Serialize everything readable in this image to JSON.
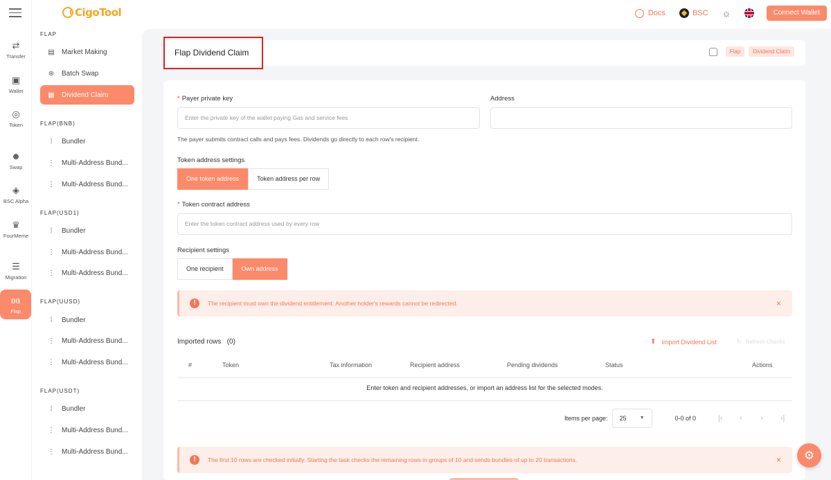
{
  "app": {
    "logo_text": "CigoTool",
    "docs_label": "Docs",
    "network_label": "BSC",
    "connect_label": "Connect Wallet"
  },
  "rail": [
    {
      "label": "Transfer",
      "icon": "transfer-icon"
    },
    {
      "label": "Wallet",
      "icon": "wallet-icon"
    },
    {
      "label": "Token",
      "icon": "token-icon"
    },
    {
      "label": "Swap",
      "icon": "swap-icon"
    },
    {
      "label": "BSC Alpha",
      "icon": "bsc-alpha-icon"
    },
    {
      "label": "FourMeme",
      "icon": "fourmeme-icon"
    },
    {
      "label": "Migration",
      "icon": "migration-icon"
    },
    {
      "label": "Flap",
      "icon": "butterfly-icon",
      "active": true
    }
  ],
  "subnav": {
    "groups": [
      {
        "label": "FLAP",
        "items": [
          "Market Making",
          "Batch Swap",
          "Dividend Claim"
        ]
      },
      {
        "label": "FLAP(BNB)",
        "items": [
          "Bundler",
          "Multi-Address Bund...",
          "Multi-Address Bund..."
        ]
      },
      {
        "label": "FLAP(USD1)",
        "items": [
          "Bundler",
          "Multi-Address Bund...",
          "Multi-Address Bund..."
        ]
      },
      {
        "label": "FLAP(UUSD)",
        "items": [
          "Bundler",
          "Multi-Address Bund...",
          "Multi-Address Bund..."
        ]
      },
      {
        "label": "FLAP(USDT)",
        "items": [
          "Bundler",
          "Multi-Address Bund...",
          "Multi-Address Bund..."
        ]
      }
    ]
  },
  "page": {
    "title": "Flap Dividend Claim",
    "breadcrumb": [
      "Flap",
      "Dividend Claim"
    ]
  },
  "form": {
    "payer_label": "Payer private key",
    "payer_required": "*",
    "payer_placeholder": "Enter the private key of the wallet paying Gas and service fees",
    "address_label": "Address",
    "address_value": "",
    "payer_hint": "The payer submits contract calls and pays fees. Dividends go directly to each row's recipient.",
    "token_settings_label": "Token address settings",
    "token_options": [
      "One token address",
      "Token address per row"
    ],
    "token_selected": 0,
    "token_contract_label": "Token contract address",
    "token_contract_required": "*",
    "token_contract_placeholder": "Enter the token contract address used by every row",
    "recipient_settings_label": "Recipient settings",
    "recipient_options": [
      "One recipient",
      "Own address"
    ],
    "recipient_selected": 1,
    "alert_recipient": "The recipient must own the dividend entitlement. Another holder's rewards cannot be redirected.",
    "alert_close": "×"
  },
  "table": {
    "title": "Imported rows",
    "count": "(0)",
    "import_label": "Import Dividend List",
    "refresh_label": "Refresh Checks",
    "columns": [
      "#",
      "Token",
      "Tax information",
      "Recipient address",
      "Pending dividends",
      "Status",
      "Actions"
    ],
    "empty_text": "Enter token and recipient addresses, or import an address list for the selected modes."
  },
  "pagination": {
    "items_per_page_label": "Items per page:",
    "page_size": "25",
    "range": "0-0 of 0"
  },
  "alert_bottom": "The first 10 rows are checked initially. Starting the task checks the remaining rows in groups of 10 and sends bundles of up to 20 transactions.",
  "colors": {
    "accent": "#fb8a6a",
    "accent_text": "#f47656",
    "highlight_box": "#e02020"
  }
}
